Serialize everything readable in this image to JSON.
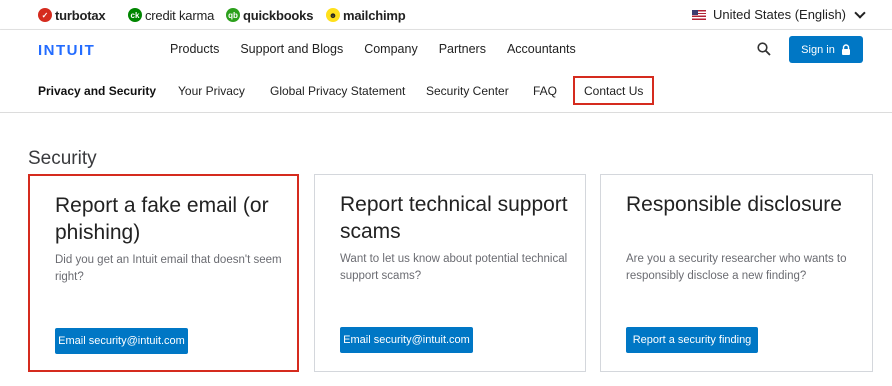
{
  "brands": [
    {
      "name": "turbotax",
      "icon": "turbotax-logo-icon",
      "color": "#d52b1e"
    },
    {
      "name": "credit karma",
      "icon": "creditkarma-logo-icon",
      "color": "#008600"
    },
    {
      "name": "quickbooks",
      "icon": "quickbooks-logo-icon",
      "color": "#2ca01c"
    },
    {
      "name": "mailchimp",
      "icon": "mailchimp-logo-icon",
      "color": "#ffe01b"
    }
  ],
  "locale": {
    "label": "United States (English)",
    "icon": "us-flag-icon"
  },
  "nav": {
    "logo": "INTUIT",
    "links": [
      "Products",
      "Support and Blogs",
      "Company",
      "Partners",
      "Accountants"
    ],
    "signin_label": "Sign in"
  },
  "subnav": {
    "items": [
      "Privacy and Security",
      "Your Privacy",
      "Global Privacy Statement",
      "Security Center",
      "FAQ",
      "Contact Us"
    ]
  },
  "section": {
    "title": "Security"
  },
  "cards": [
    {
      "title_line1": "Report a fake email (or",
      "title_line2": "phishing)",
      "desc_line1": "Did you get an Intuit email that doesn't seem",
      "desc_line2": "right?",
      "button": "Email security@intuit.com"
    },
    {
      "title_line1": "Report technical support",
      "title_line2": "scams",
      "desc_line1": "Want to let us know about potential technical",
      "desc_line2": "support scams?",
      "button": "Email security@intuit.com"
    },
    {
      "title_line1": "Responsible disclosure",
      "desc_line1": "Are you a security researcher who wants to",
      "desc_line2": "responsibly disclose a new finding?",
      "button": "Report a security finding"
    }
  ],
  "colors": {
    "accent": "#0077c5",
    "logo": "#236cff",
    "highlight": "#d52b1e"
  }
}
